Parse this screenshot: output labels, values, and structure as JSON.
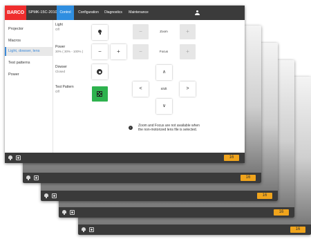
{
  "app": {
    "logo": "BARCO",
    "device_name": "SPMK-15C-2010",
    "tabs": [
      "Control",
      "Configuration",
      "Diagnostics",
      "Maintenance"
    ],
    "active_tab": "Control"
  },
  "sidebar": {
    "items": [
      {
        "label": "Projector",
        "active": false
      },
      {
        "label": "Macros",
        "active": false
      },
      {
        "label": "Light, dowser, lens",
        "active": true
      },
      {
        "label": "Test patterns",
        "active": false
      },
      {
        "label": "Power",
        "active": false
      }
    ]
  },
  "controls": {
    "light": {
      "label": "Light",
      "value": "Off"
    },
    "power": {
      "label": "Power",
      "value": "30% ( 30% - 100% )",
      "minus": "−",
      "plus": "+"
    },
    "dowser": {
      "label": "Dowser",
      "value": "Closed"
    },
    "test_pattern": {
      "label": "Test Pattern",
      "value": "Off"
    }
  },
  "lens": {
    "zoom_label": "Zoom",
    "focus_label": "Focus",
    "shift_label": "Shift",
    "minus": "−",
    "plus": "+",
    "up": "∧",
    "down": "∨",
    "left": "<",
    "right": ">",
    "info_icon": "i",
    "info_text": "Zoom and Focus are not available when the non-motorized lens file is selected."
  },
  "statusbar": {
    "badge": "16"
  },
  "colors": {
    "topbar": "#3b3b3b",
    "accent": "#2f8ee0",
    "logo": "#ef2d2d",
    "active_pattern": "#2eb24e",
    "badge": "#f0a41c"
  },
  "icons": [
    "bulb-icon",
    "shutter-icon",
    "test-pattern-icon",
    "user-icon",
    "info-icon"
  ]
}
